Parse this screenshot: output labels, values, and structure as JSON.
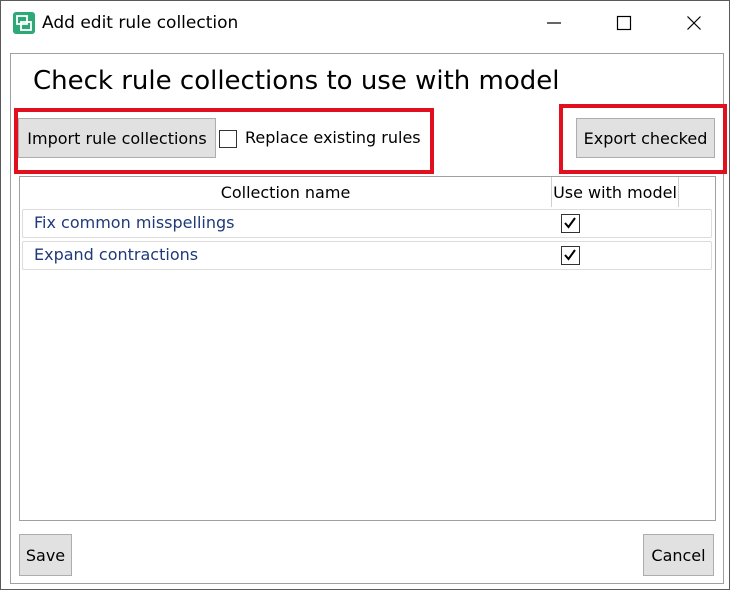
{
  "window": {
    "title": "Add edit rule collection",
    "controls": {
      "minimize": "—",
      "maximize": "☐",
      "close": "✕"
    }
  },
  "heading": "Check rule collections to use with model",
  "toolbar": {
    "import_label": "Import rule collections",
    "replace_label": "Replace existing rules",
    "replace_checked": false,
    "export_label": "Export checked"
  },
  "grid": {
    "columns": [
      "Collection name",
      "Use with model"
    ],
    "rows": [
      {
        "name": "Fix common misspellings",
        "use_with_model": true
      },
      {
        "name": "Expand contractions",
        "use_with_model": true
      }
    ]
  },
  "footer": {
    "save_label": "Save",
    "cancel_label": "Cancel"
  },
  "colors": {
    "highlight": "#e0101f",
    "row_text": "#1f3a7a",
    "app_icon": "#2fa877"
  },
  "icons": {
    "app": "app-icon",
    "check": "checkmark-icon"
  }
}
